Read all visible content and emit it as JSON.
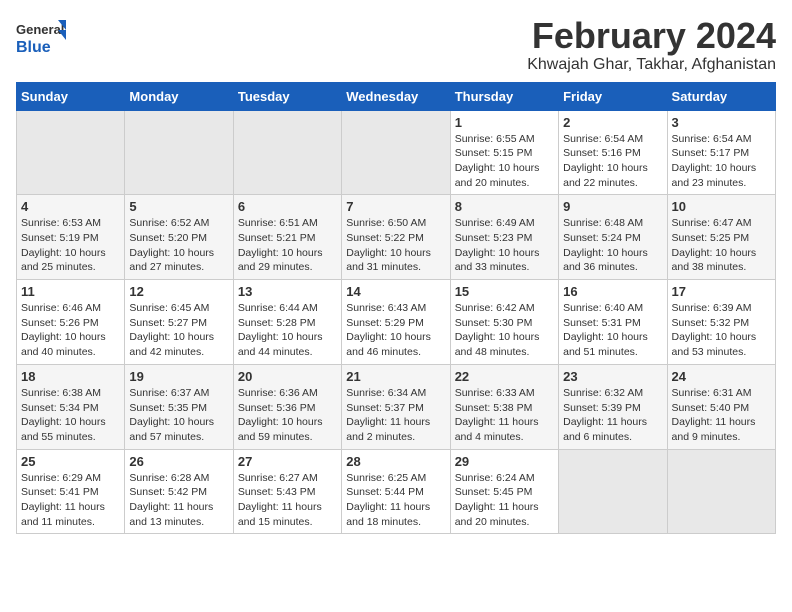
{
  "logo": {
    "line1": "General",
    "line2": "Blue"
  },
  "title": "February 2024",
  "subtitle": "Khwajah Ghar, Takhar, Afghanistan",
  "headers": [
    "Sunday",
    "Monday",
    "Tuesday",
    "Wednesday",
    "Thursday",
    "Friday",
    "Saturday"
  ],
  "weeks": [
    [
      {
        "day": "",
        "info": ""
      },
      {
        "day": "",
        "info": ""
      },
      {
        "day": "",
        "info": ""
      },
      {
        "day": "",
        "info": ""
      },
      {
        "day": "1",
        "info": "Sunrise: 6:55 AM\nSunset: 5:15 PM\nDaylight: 10 hours\nand 20 minutes."
      },
      {
        "day": "2",
        "info": "Sunrise: 6:54 AM\nSunset: 5:16 PM\nDaylight: 10 hours\nand 22 minutes."
      },
      {
        "day": "3",
        "info": "Sunrise: 6:54 AM\nSunset: 5:17 PM\nDaylight: 10 hours\nand 23 minutes."
      }
    ],
    [
      {
        "day": "4",
        "info": "Sunrise: 6:53 AM\nSunset: 5:19 PM\nDaylight: 10 hours\nand 25 minutes."
      },
      {
        "day": "5",
        "info": "Sunrise: 6:52 AM\nSunset: 5:20 PM\nDaylight: 10 hours\nand 27 minutes."
      },
      {
        "day": "6",
        "info": "Sunrise: 6:51 AM\nSunset: 5:21 PM\nDaylight: 10 hours\nand 29 minutes."
      },
      {
        "day": "7",
        "info": "Sunrise: 6:50 AM\nSunset: 5:22 PM\nDaylight: 10 hours\nand 31 minutes."
      },
      {
        "day": "8",
        "info": "Sunrise: 6:49 AM\nSunset: 5:23 PM\nDaylight: 10 hours\nand 33 minutes."
      },
      {
        "day": "9",
        "info": "Sunrise: 6:48 AM\nSunset: 5:24 PM\nDaylight: 10 hours\nand 36 minutes."
      },
      {
        "day": "10",
        "info": "Sunrise: 6:47 AM\nSunset: 5:25 PM\nDaylight: 10 hours\nand 38 minutes."
      }
    ],
    [
      {
        "day": "11",
        "info": "Sunrise: 6:46 AM\nSunset: 5:26 PM\nDaylight: 10 hours\nand 40 minutes."
      },
      {
        "day": "12",
        "info": "Sunrise: 6:45 AM\nSunset: 5:27 PM\nDaylight: 10 hours\nand 42 minutes."
      },
      {
        "day": "13",
        "info": "Sunrise: 6:44 AM\nSunset: 5:28 PM\nDaylight: 10 hours\nand 44 minutes."
      },
      {
        "day": "14",
        "info": "Sunrise: 6:43 AM\nSunset: 5:29 PM\nDaylight: 10 hours\nand 46 minutes."
      },
      {
        "day": "15",
        "info": "Sunrise: 6:42 AM\nSunset: 5:30 PM\nDaylight: 10 hours\nand 48 minutes."
      },
      {
        "day": "16",
        "info": "Sunrise: 6:40 AM\nSunset: 5:31 PM\nDaylight: 10 hours\nand 51 minutes."
      },
      {
        "day": "17",
        "info": "Sunrise: 6:39 AM\nSunset: 5:32 PM\nDaylight: 10 hours\nand 53 minutes."
      }
    ],
    [
      {
        "day": "18",
        "info": "Sunrise: 6:38 AM\nSunset: 5:34 PM\nDaylight: 10 hours\nand 55 minutes."
      },
      {
        "day": "19",
        "info": "Sunrise: 6:37 AM\nSunset: 5:35 PM\nDaylight: 10 hours\nand 57 minutes."
      },
      {
        "day": "20",
        "info": "Sunrise: 6:36 AM\nSunset: 5:36 PM\nDaylight: 10 hours\nand 59 minutes."
      },
      {
        "day": "21",
        "info": "Sunrise: 6:34 AM\nSunset: 5:37 PM\nDaylight: 11 hours\nand 2 minutes."
      },
      {
        "day": "22",
        "info": "Sunrise: 6:33 AM\nSunset: 5:38 PM\nDaylight: 11 hours\nand 4 minutes."
      },
      {
        "day": "23",
        "info": "Sunrise: 6:32 AM\nSunset: 5:39 PM\nDaylight: 11 hours\nand 6 minutes."
      },
      {
        "day": "24",
        "info": "Sunrise: 6:31 AM\nSunset: 5:40 PM\nDaylight: 11 hours\nand 9 minutes."
      }
    ],
    [
      {
        "day": "25",
        "info": "Sunrise: 6:29 AM\nSunset: 5:41 PM\nDaylight: 11 hours\nand 11 minutes."
      },
      {
        "day": "26",
        "info": "Sunrise: 6:28 AM\nSunset: 5:42 PM\nDaylight: 11 hours\nand 13 minutes."
      },
      {
        "day": "27",
        "info": "Sunrise: 6:27 AM\nSunset: 5:43 PM\nDaylight: 11 hours\nand 15 minutes."
      },
      {
        "day": "28",
        "info": "Sunrise: 6:25 AM\nSunset: 5:44 PM\nDaylight: 11 hours\nand 18 minutes."
      },
      {
        "day": "29",
        "info": "Sunrise: 6:24 AM\nSunset: 5:45 PM\nDaylight: 11 hours\nand 20 minutes."
      },
      {
        "day": "",
        "info": ""
      },
      {
        "day": "",
        "info": ""
      }
    ]
  ]
}
